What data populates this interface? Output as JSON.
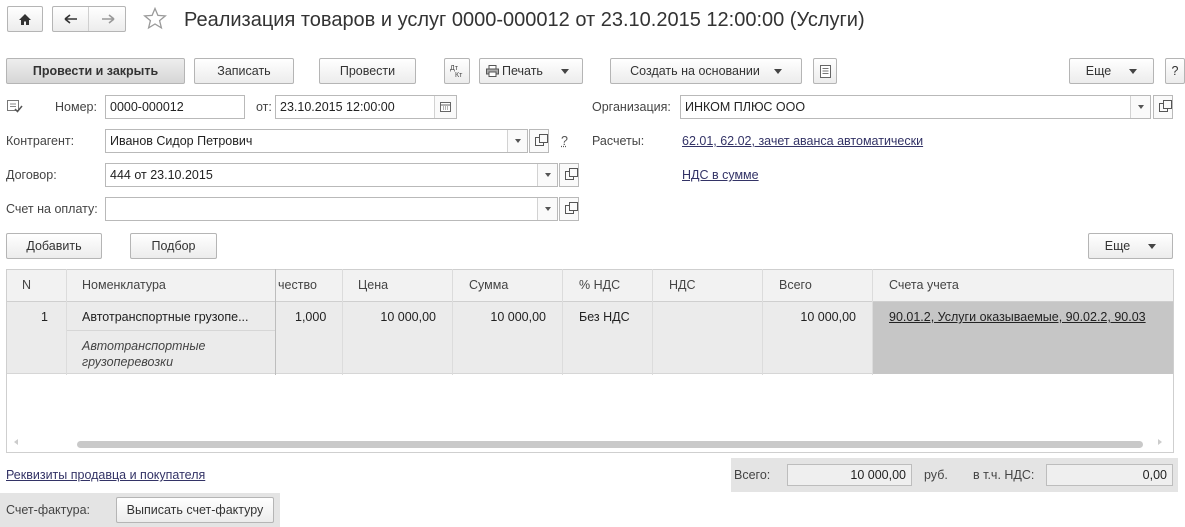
{
  "nav": {
    "home_icon": "home-icon",
    "back_icon": "arrow-left-icon",
    "forward_icon": "arrow-right-icon",
    "favorite_icon": "star-icon"
  },
  "title": "Реализация товаров и услуг 0000-000012 от 23.10.2015 12:00:00 (Услуги)",
  "toolbar": {
    "post_close": "Провести и закрыть",
    "save": "Записать",
    "post": "Провести",
    "print": "Печать",
    "create_based": "Создать на основании",
    "more": "Еще",
    "help": "?"
  },
  "form": {
    "number_label": "Номер:",
    "number_value": "0000-000012",
    "date_label": "от:",
    "date_value": "23.10.2015 12:00:00",
    "org_label": "Организация:",
    "org_value": "ИНКОМ ПЛЮС ООО",
    "counterparty_label": "Контрагент:",
    "counterparty_value": "Иванов Сидор Петрович",
    "counterparty_help": "?",
    "settlements_label": "Расчеты:",
    "settlements_link": "62.01, 62.02, зачет аванса автоматически",
    "contract_label": "Договор:",
    "contract_value": "444 от 23.10.2015",
    "vat_link": "НДС в сумме",
    "invoice_label": "Счет на оплату:",
    "invoice_value": ""
  },
  "table_toolbar": {
    "add": "Добавить",
    "select": "Подбор",
    "more": "Еще"
  },
  "table": {
    "columns": [
      "N",
      "Номенклатура",
      "чество",
      "Цена",
      "Сумма",
      "% НДС",
      "НДС",
      "Всего",
      "Счета учета"
    ],
    "rows": [
      {
        "n": "1",
        "item": "Автотранспортные грузопе...",
        "item_content": "Автотранспортные грузоперевозки",
        "qty": "1,000",
        "price": "10 000,00",
        "sum": "10 000,00",
        "vat_rate": "Без НДС",
        "vat": "",
        "total": "10 000,00",
        "accounts": "90.01.2, Услуги оказываемые, 90.02.2, 90.03"
      }
    ]
  },
  "footer": {
    "requisites_link": "Реквизиты продавца и покупателя",
    "total_label": "Всего:",
    "total_value": "10 000,00",
    "currency": "руб.",
    "vat_label": "в т.ч. НДС:",
    "vat_value": "0,00",
    "invoice_label": "Счет-фактура:",
    "invoice_button": "Выписать счет-фактуру"
  }
}
